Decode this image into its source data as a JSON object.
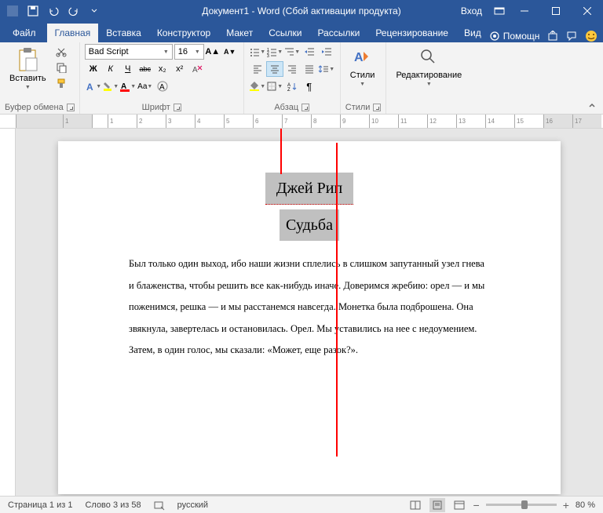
{
  "title": "Документ1 - Word (Сбой активации продукта)",
  "signin": "Вход",
  "tabs": {
    "file": "Файл",
    "home": "Главная",
    "insert": "Вставка",
    "design": "Конструктор",
    "layout": "Макет",
    "references": "Ссылки",
    "mailings": "Рассылки",
    "review": "Рецензирование",
    "view": "Вид"
  },
  "help_hint": "Помощн",
  "groups": {
    "clipboard": "Буфер обмена",
    "font": "Шрифт",
    "paragraph": "Абзац",
    "styles": "Стили",
    "editing": "Редактирование"
  },
  "clipboard": {
    "paste": "Вставить"
  },
  "font": {
    "family": "Bad Script",
    "size": "16",
    "bold": "Ж",
    "italic": "К",
    "underline": "Ч",
    "strike": "abc",
    "sub": "x₂",
    "sup": "x²"
  },
  "styles_btn": "Стили",
  "document": {
    "title_line": "Джей Рип",
    "subtitle": "Судьба",
    "body": "Был только один выход, ибо наши жизни сплелись в слишком запутанный узел гнева и блаженства, чтобы решить все как-нибудь иначе. Доверимся жребию: орел — и мы поженимся, решка — и мы расстанемся навсегда. Монетка была подброшена. Она звякнула, завертелась и остановилась. Орел. Мы уставились на нее с недоумением.",
    "body2": "Затем, в один голос, мы сказали: «Может, еще разок?»."
  },
  "status": {
    "page": "Страница 1 из 1",
    "words": "Слово 3 из 58",
    "lang": "русский",
    "zoom": "80 %"
  },
  "ruler_marks": [
    "1",
    "",
    "1",
    "2",
    "3",
    "4",
    "5",
    "6",
    "7",
    "8",
    "9",
    "10",
    "11",
    "12",
    "13",
    "14",
    "15",
    "16",
    "17"
  ]
}
